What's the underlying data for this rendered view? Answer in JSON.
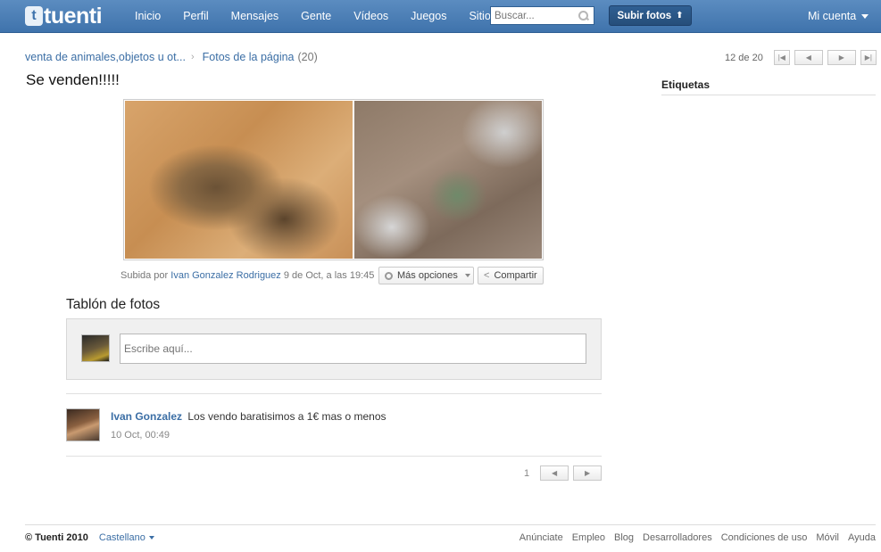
{
  "header": {
    "logo_text": "tuenti",
    "nav": [
      "Inicio",
      "Perfil",
      "Mensajes",
      "Gente",
      "Vídeos",
      "Juegos",
      "Sitios"
    ],
    "search_placeholder": "Buscar...",
    "upload_label": "Subir fotos",
    "account_label": "Mi cuenta"
  },
  "breadcrumb": {
    "page": "venta de animales,objetos u ot...",
    "photos": "Fotos de la página",
    "count": "(20)"
  },
  "pager": {
    "position": "12 de 20"
  },
  "photo": {
    "title": "Se venden!!!!!",
    "uploaded_prefix": "Subida por",
    "uploader": "Ivan Gonzalez Rodriguez",
    "date": "9 de Oct, a las 19:45",
    "options_label": "Más opciones",
    "share_label": "Compartir"
  },
  "wall": {
    "title": "Tablón de fotos",
    "input_placeholder": "Escribe aquí..."
  },
  "comment": {
    "author": "Ivan Gonzalez",
    "text": "Los vendo baratisimos a 1€ mas o menos",
    "date": "10 Oct, 00:49"
  },
  "comment_pager": {
    "page": "1"
  },
  "sidebar": {
    "tags_title": "Etiquetas"
  },
  "footer": {
    "copyright": "© Tuenti 2010",
    "language": "Castellano",
    "links": [
      "Anúnciate",
      "Empleo",
      "Blog",
      "Desarrolladores",
      "Condiciones de uso",
      "Móvil",
      "Ayuda"
    ]
  },
  "colors": {
    "header_bg": "#4a7fb7",
    "link": "#3b6ea5",
    "upload_bg": "#2f5f93"
  }
}
